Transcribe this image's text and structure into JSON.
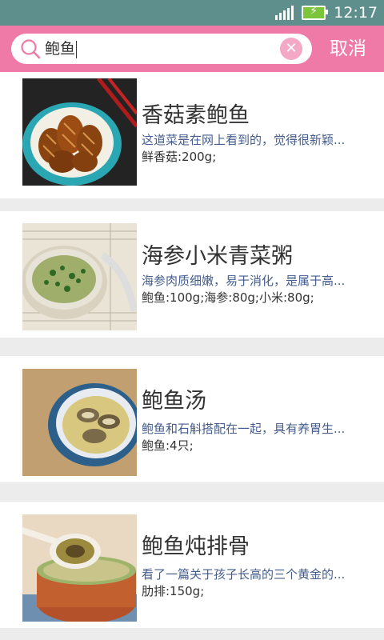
{
  "status": {
    "time": "12:17"
  },
  "search": {
    "query": "鲍鱼",
    "cancel_label": "取消"
  },
  "results": [
    {
      "title": "香菇素鲍鱼",
      "description": "这道菜是在网上看到的，觉得很新颖...",
      "ingredients": "鲜香菇:200g;"
    },
    {
      "title": "海参小米青菜粥",
      "description": "海参肉质细嫩，易于消化，是属于高...",
      "ingredients": "鲍鱼:100g;海参:80g;小米:80g;"
    },
    {
      "title": "鲍鱼汤",
      "description": "鲍鱼和石斛搭配在一起，具有养胃生...",
      "ingredients": "鲍鱼:4只;"
    },
    {
      "title": "鲍鱼炖排骨",
      "description": "看了一篇关于孩子长高的三个黄金的...",
      "ingredients": "肋排:150g;"
    }
  ],
  "colors": {
    "status_bar": "#5e8f8c",
    "search_bar": "#f07aa7",
    "desc_text": "#445d8c"
  }
}
